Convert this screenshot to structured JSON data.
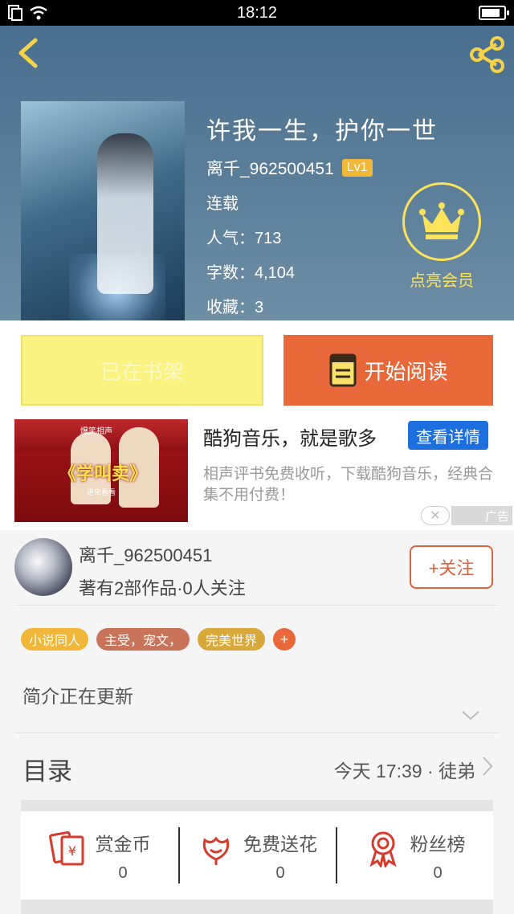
{
  "status": {
    "time": "18:12"
  },
  "book": {
    "title": "许我一生，护你一世",
    "author": "离千_962500451",
    "level": "Lv1",
    "status": "连载",
    "popularity": "人气：713",
    "words": "字数：4,104",
    "favorites": "收藏：3"
  },
  "vip": {
    "label": "点亮会员"
  },
  "actions": {
    "shelf_label": "已在书架",
    "read_label": "开始阅读"
  },
  "ad": {
    "title": "酷狗音乐，就是歌多",
    "detail_label": "查看详情",
    "description": "相声评书免费收听，下载酷狗音乐，经典合集不用付费！",
    "badge": "广告",
    "image_text": {
      "top": "爆笑相声",
      "main": "《学叫卖》",
      "bottom": "进来看看"
    }
  },
  "author_card": {
    "name": "离千_962500451",
    "stats": "著有2部作品·0人关注",
    "follow_label": "+关注"
  },
  "tags": [
    {
      "label": "小说同人",
      "color": "#f1b738"
    },
    {
      "label": "主受，宠文，",
      "color": "#c9735a"
    },
    {
      "label": "完美世界",
      "color": "#d8a83a"
    }
  ],
  "tag_add_label": "+",
  "intro": "简介正在更新",
  "toc": {
    "label": "目录",
    "latest": "今天 17:39 · 徒弟"
  },
  "stats": [
    {
      "label": "赏金币",
      "value": "0",
      "icon": "red-envelope-icon"
    },
    {
      "label": "免费送花",
      "value": "0",
      "icon": "flower-icon"
    },
    {
      "label": "粉丝榜",
      "value": "0",
      "icon": "ribbon-medal-icon"
    }
  ],
  "colors": {
    "accent": "#e8683a",
    "vip": "#fbe45a",
    "shelf": "#fcf281",
    "ad_button": "#1d6fe0"
  }
}
